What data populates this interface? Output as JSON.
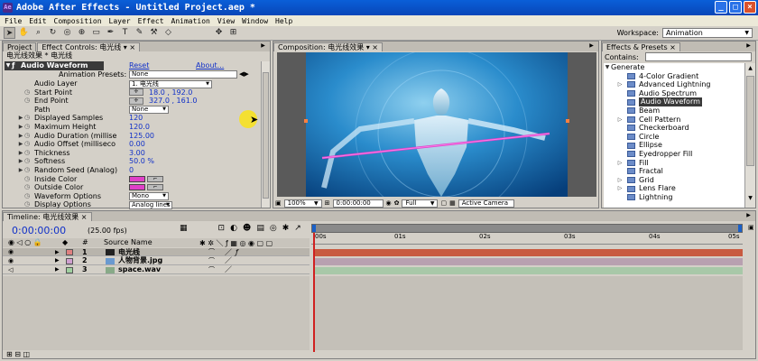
{
  "window": {
    "title": "Adobe After Effects - Untitled Project.aep *"
  },
  "menu": [
    "File",
    "Edit",
    "Composition",
    "Layer",
    "Effect",
    "Animation",
    "View",
    "Window",
    "Help"
  ],
  "workspace": {
    "label": "Workspace:",
    "value": "Animation"
  },
  "project_panel": {
    "tab": "Project"
  },
  "effect_controls": {
    "tab": "Effect Controls: 电光线",
    "header": "电光线效果 * 电光线",
    "effect": {
      "name": "Audio Waveform",
      "reset": "Reset",
      "about": "About..."
    },
    "animation_presets": {
      "label": "Animation Presets:",
      "value": "None"
    },
    "props": [
      {
        "name": "Audio Layer",
        "value": "1. 电光线",
        "kind": "dropdown"
      },
      {
        "name": "Start Point",
        "value": "18.0 , 192.0",
        "kind": "point"
      },
      {
        "name": "End Point",
        "value": "327.0 , 161.0",
        "kind": "point"
      },
      {
        "name": "Path",
        "value": "None",
        "kind": "dropdown"
      },
      {
        "name": "Displayed Samples",
        "value": "120"
      },
      {
        "name": "Maximum Height",
        "value": "120.0"
      },
      {
        "name": "Audio Duration (millise",
        "value": "125.00"
      },
      {
        "name": "Audio Offset (milliseco",
        "value": "0.00"
      },
      {
        "name": "Thickness",
        "value": "3.00"
      },
      {
        "name": "Softness",
        "value": "50.0 %"
      },
      {
        "name": "Random Seed (Analog)",
        "value": "0"
      },
      {
        "name": "Inside Color",
        "value": "",
        "color": "#e040c8"
      },
      {
        "name": "Outside Color",
        "value": "",
        "color": "#e040c8"
      },
      {
        "name": "Waveform Options",
        "value": "Mono",
        "kind": "dropdown"
      },
      {
        "name": "Display Options",
        "value": "Analog lines",
        "kind": "dropdown"
      }
    ]
  },
  "composition": {
    "tab": "Composition: 电光线效果",
    "zoom": "100%",
    "timecode": "0:00:00:00",
    "resolution": "Full",
    "camera": "Active Camera"
  },
  "effects_presets": {
    "tab": "Effects & Presets",
    "contains_label": "Contains:",
    "category": "Generate",
    "items": [
      "4-Color Gradient",
      "Advanced Lightning",
      "Audio Spectrum",
      "Audio Waveform",
      "Beam",
      "Cell Pattern",
      "Checkerboard",
      "Circle",
      "Ellipse",
      "Eyedropper Fill",
      "Fill",
      "Fractal",
      "Grid",
      "Lens Flare",
      "Lightning"
    ],
    "selected": "Audio Waveform"
  },
  "timeline": {
    "tab": "Timeline: 电光线效果",
    "timecode": "0:00:00:00",
    "fps": "(25.00 fps)",
    "column_header": "Source Name",
    "hash_header": "#",
    "layers": [
      {
        "num": "1",
        "name": "电光线",
        "color": "#e08080",
        "bar_color": "#c85a40"
      },
      {
        "num": "2",
        "name": "人物背景.jpg",
        "color": "#d0a0d0",
        "bar_color": "#b8a0b0"
      },
      {
        "num": "3",
        "name": "space.wav",
        "color": "#a0d0a0",
        "bar_color": "#a8c8a8"
      }
    ],
    "ruler": [
      "00s",
      "01s",
      "02s",
      "03s",
      "04s",
      "05s"
    ]
  }
}
